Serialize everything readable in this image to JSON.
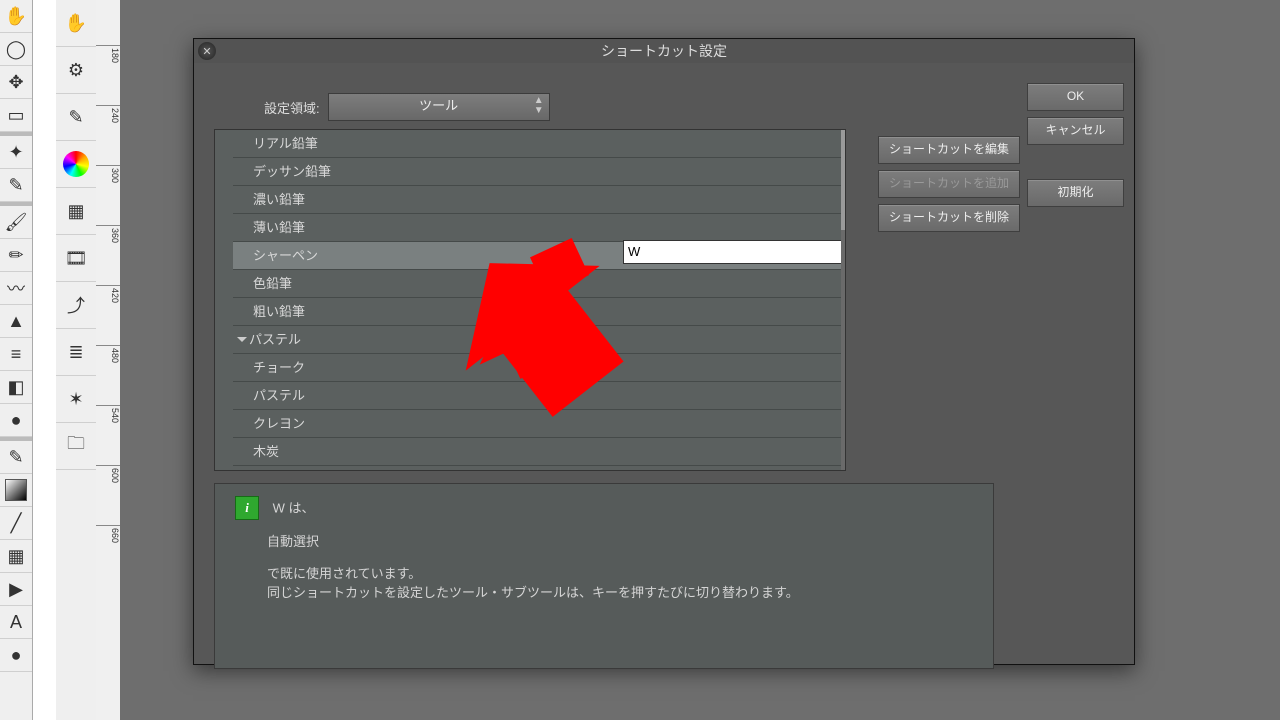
{
  "dialog": {
    "title": "ショートカット設定",
    "area_label": "設定領域:",
    "area_value": "ツール"
  },
  "buttons": {
    "ok": "OK",
    "cancel": "キャンセル",
    "init": "初期化",
    "edit": "ショートカットを編集",
    "add": "ショートカットを追加",
    "delete": "ショートカットを削除"
  },
  "list": [
    {
      "label": "リアル鉛筆",
      "group": false
    },
    {
      "label": "デッサン鉛筆",
      "group": false
    },
    {
      "label": "濃い鉛筆",
      "group": false
    },
    {
      "label": "薄い鉛筆",
      "group": false
    },
    {
      "label": "シャーペン",
      "group": false,
      "selected": true,
      "shortcut": "W"
    },
    {
      "label": "色鉛筆",
      "group": false
    },
    {
      "label": "粗い鉛筆",
      "group": false
    },
    {
      "label": "パステル",
      "group": true
    },
    {
      "label": "チョーク",
      "group": false
    },
    {
      "label": "パステル",
      "group": false
    },
    {
      "label": "クレヨン",
      "group": false
    },
    {
      "label": "木炭",
      "group": false
    }
  ],
  "shortcut_input_value": "W",
  "info": {
    "line1": "W は、",
    "line2": "自動選択",
    "line3": "で既に使用されています。",
    "line4": "同じショートカットを設定したツール・サブツールは、キーを押すたびに切り替わります。"
  },
  "ruler_ticks": [
    "180",
    "240",
    "300",
    "360",
    "420",
    "480",
    "540",
    "600",
    "660"
  ]
}
